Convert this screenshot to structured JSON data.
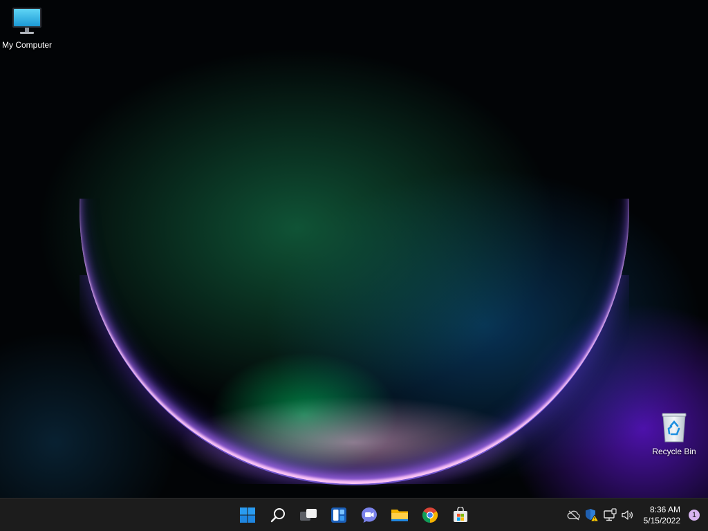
{
  "desktop": {
    "icons": [
      {
        "label": "My Computer",
        "icon": "monitor-icon"
      },
      {
        "label": "Recycle Bin",
        "icon": "recycle-bin-icon"
      }
    ]
  },
  "taskbar": {
    "pinned": [
      {
        "name": "Start",
        "icon": "windows-start-icon"
      },
      {
        "name": "Search",
        "icon": "search-icon"
      },
      {
        "name": "Task View",
        "icon": "task-view-icon"
      },
      {
        "name": "Widgets",
        "icon": "widgets-icon"
      },
      {
        "name": "Chat",
        "icon": "teams-chat-icon"
      },
      {
        "name": "File Explorer",
        "icon": "folder-icon"
      },
      {
        "name": "Google Chrome",
        "icon": "chrome-icon"
      },
      {
        "name": "Microsoft Store",
        "icon": "store-icon"
      }
    ],
    "tray": {
      "icons": [
        "onedrive-offline-icon",
        "security-warning-icon",
        "network-icon",
        "volume-icon"
      ],
      "time": "8:36 AM",
      "date": "5/15/2022",
      "notification_count": "1"
    }
  },
  "colors": {
    "taskbar_bg": "#1c1c1c",
    "accent": "#2a9bf0",
    "notification_badge": "#d7b4f0"
  }
}
